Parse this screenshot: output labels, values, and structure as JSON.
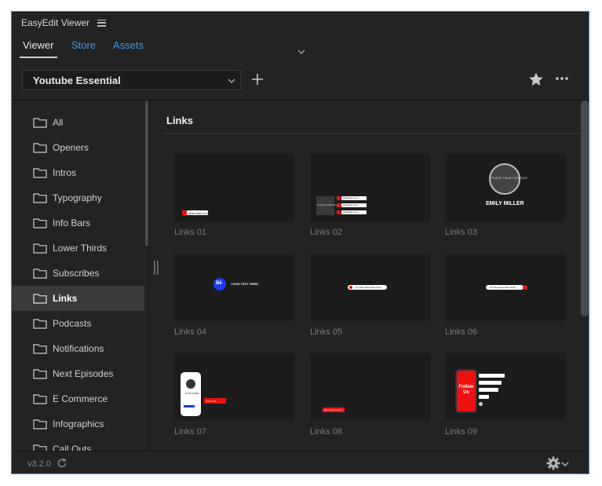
{
  "app": {
    "title": "EasyEdit Viewer"
  },
  "tabs": [
    {
      "label": "Viewer",
      "active": true
    },
    {
      "label": "Store",
      "active": false
    },
    {
      "label": "Assets",
      "active": false
    }
  ],
  "toolbar": {
    "collection_select": "Youtube Essential"
  },
  "sidebar": {
    "items": [
      {
        "label": "All"
      },
      {
        "label": "Openers"
      },
      {
        "label": "Intros"
      },
      {
        "label": "Typography"
      },
      {
        "label": "Info Bars"
      },
      {
        "label": "Lower Thirds"
      },
      {
        "label": "Subscribes"
      },
      {
        "label": "Links",
        "active": true
      },
      {
        "label": "Podcasts"
      },
      {
        "label": "Notifications"
      },
      {
        "label": "Next Episodes"
      },
      {
        "label": "E Commerce"
      },
      {
        "label": "Infographics"
      },
      {
        "label": "Call Outs"
      }
    ]
  },
  "content": {
    "section_title": "Links",
    "items": [
      {
        "label": "Links 01",
        "texts": [
          "@domain.com"
        ]
      },
      {
        "label": "Links 02",
        "texts": [
          "PLACE YOUR CONTENT",
          "@linkedin.com",
          "@linkedin.com",
          "@linkedin.com"
        ]
      },
      {
        "label": "Links 03",
        "texts": [
          "PLACE YOUR CONTENT",
          "EMILY MILLER"
        ]
      },
      {
        "label": "Links 04",
        "texts": [
          "Bē",
          "YOUR TEXT HERE"
        ]
      },
      {
        "label": "Links 05",
        "texts": [
          "YouTube Essential Library"
        ]
      },
      {
        "label": "Links 06",
        "texts": [
          "YouTube Essential Library"
        ]
      },
      {
        "label": "Links 07",
        "texts": [
          "YOUR NAME",
          "Follow Me"
        ]
      },
      {
        "label": "Links 08",
        "texts": [
          "@yourname.com"
        ]
      },
      {
        "label": "Links 09",
        "texts": [
          "Follow Us"
        ]
      }
    ]
  },
  "footer": {
    "version": "v3.2.0"
  },
  "colors": {
    "accent_blue": "#3d9aee",
    "panel_bg": "#232323",
    "thumb_bg": "#1c1c1c",
    "brand_red": "#e11111",
    "window_border": "#3c82d8"
  }
}
